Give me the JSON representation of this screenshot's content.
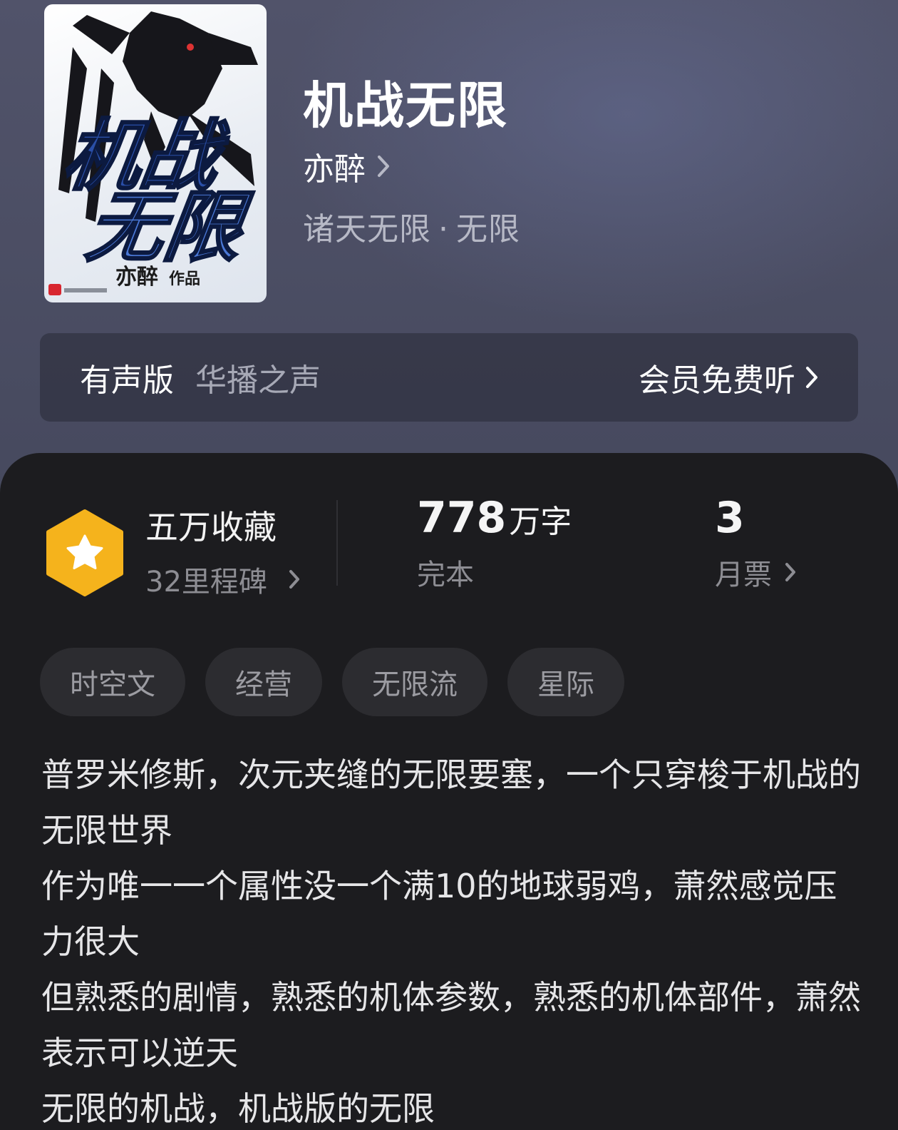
{
  "book": {
    "title": "机战无限",
    "author": "亦醉",
    "category": "诸天无限",
    "subcategory": "无限",
    "separator": "·"
  },
  "cover": {
    "title_art": "机战无限",
    "author_art": "亦醉",
    "suffix_art": "作品"
  },
  "audio": {
    "label": "有声版",
    "narrator": "华播之声",
    "action": "会员免费听"
  },
  "stats": {
    "collect_title": "五万收藏",
    "milestone": "32里程碑",
    "word_count": "778",
    "word_unit": "万字",
    "status": "完本",
    "monthly_tickets": "3",
    "monthly_label": "月票"
  },
  "tags": [
    "时空文",
    "经营",
    "无限流",
    "星际"
  ],
  "synopsis": [
    "普罗米修斯，次元夹缝的无限要塞，一个只穿梭于机战的无限世界",
    "作为唯一一个属性没一个满10的地球弱鸡，萧然感觉压力很大",
    "但熟悉的剧情，熟悉的机体参数，熟悉的机体部件，萧然表示可以逆天",
    "无限的机战，机战版的无限"
  ],
  "colors": {
    "badge": "#f5b31c",
    "panel": "#1c1c1f",
    "tag_bg": "#2c2c30"
  },
  "icons": {
    "badge": "star-hexagon-icon",
    "chevron": "chevron-right-icon"
  }
}
